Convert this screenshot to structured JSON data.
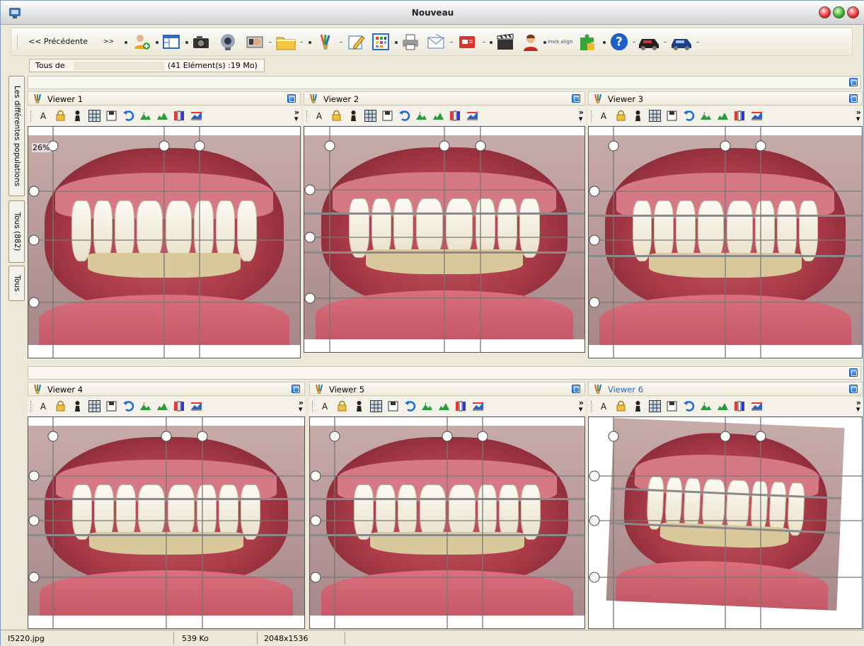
{
  "window": {
    "title": "Nouveau"
  },
  "toolbar": {
    "prev_label": "<< Précédente",
    "next_label": ">>",
    "icons": [
      "patient-add-icon",
      "window-layout-icon",
      "camera-icon",
      "webcam-icon",
      "scanner-icon",
      "folder-icon",
      "paintbrush-icon",
      "edit-pencil-icon",
      "color-grid-icon",
      "printer-icon",
      "mail-icon",
      "presentation-icon",
      "clapperboard-icon",
      "person-portrait-icon",
      "invisalign-icon",
      "puzzle-icon",
      "help-icon",
      "car-icon",
      "car-blue-icon"
    ],
    "invisalign_label": "invis align"
  },
  "filter": {
    "prefix": "Tous de",
    "info": "(41 Elément(s) :19 Mo)"
  },
  "side_tabs": [
    {
      "label": "Les différentes populations"
    },
    {
      "label": "Tous (882)"
    },
    {
      "label": "Tous"
    }
  ],
  "viewers": [
    {
      "title": "Viewer 1",
      "zoom": "26%",
      "photo": "teeth-no-braces",
      "active": false
    },
    {
      "title": "Viewer 2",
      "photo": "teeth-braces-open",
      "active": false
    },
    {
      "title": "Viewer 3",
      "photo": "teeth-braces",
      "active": false
    },
    {
      "title": "Viewer 4",
      "photo": "teeth-braces",
      "active": false
    },
    {
      "title": "Viewer 5",
      "photo": "teeth-braces",
      "active": false
    },
    {
      "title": "Viewer 6",
      "photo": "teeth-braces-rotated",
      "active": true
    }
  ],
  "viewer_tools": [
    "text-a-icon",
    "lock-icon",
    "person-icon",
    "grid-icon",
    "save-icon",
    "undo-icon",
    "mountain-left-icon",
    "mountain-right-icon",
    "color-levels-icon",
    "histogram-icon"
  ],
  "status": {
    "filename": "I5220.jpg",
    "size": "539 Ko",
    "dimensions": "2048x1536"
  },
  "colors": {
    "active_title": "#2a64b8",
    "window_bg": "#ece9d8"
  }
}
